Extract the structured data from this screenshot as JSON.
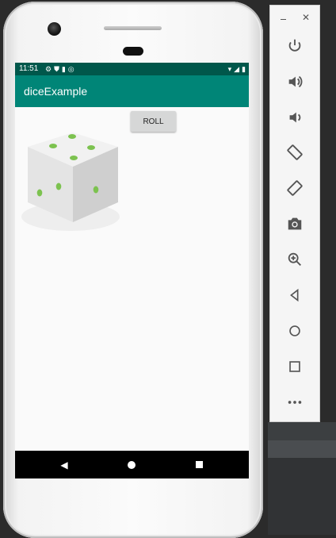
{
  "status_bar": {
    "time": "11:51",
    "left_icons": [
      "gear-icon",
      "shield-icon",
      "sd-card-icon",
      "data-saver-icon"
    ],
    "right_icons": [
      "wifi-icon",
      "signal-icon",
      "battery-icon"
    ]
  },
  "app_bar": {
    "title": "diceExample"
  },
  "main": {
    "roll_button_label": "ROLL",
    "dice_image": "dice-icon"
  },
  "nav_bar": {
    "icons": [
      "back-icon",
      "home-icon",
      "recents-icon"
    ]
  },
  "emulator_toolbar": {
    "window_controls": [
      "minimize-icon",
      "close-icon"
    ],
    "buttons": [
      "power",
      "volume-up",
      "volume-down",
      "rotate-left",
      "rotate-right",
      "screenshot",
      "zoom",
      "back",
      "home",
      "overview",
      "more"
    ]
  },
  "colors": {
    "status_bar": "#00574b",
    "app_bar": "#008577",
    "dice_dot": "#7cc24f"
  }
}
